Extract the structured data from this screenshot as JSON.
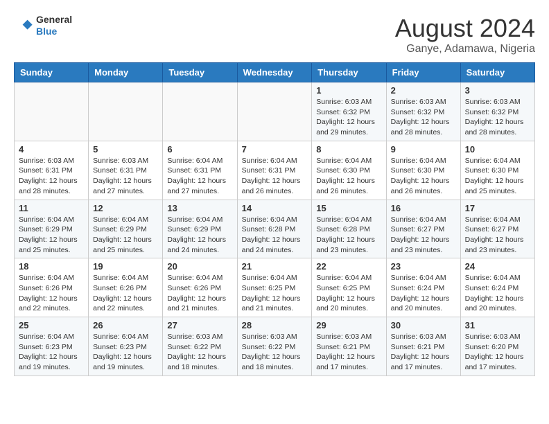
{
  "header": {
    "logo_general": "General",
    "logo_blue": "Blue",
    "month_title": "August 2024",
    "location": "Ganye, Adamawa, Nigeria"
  },
  "days_of_week": [
    "Sunday",
    "Monday",
    "Tuesday",
    "Wednesday",
    "Thursday",
    "Friday",
    "Saturday"
  ],
  "weeks": [
    [
      {
        "day": "",
        "info": ""
      },
      {
        "day": "",
        "info": ""
      },
      {
        "day": "",
        "info": ""
      },
      {
        "day": "",
        "info": ""
      },
      {
        "day": "1",
        "info": "Sunrise: 6:03 AM\nSunset: 6:32 PM\nDaylight: 12 hours\nand 29 minutes."
      },
      {
        "day": "2",
        "info": "Sunrise: 6:03 AM\nSunset: 6:32 PM\nDaylight: 12 hours\nand 28 minutes."
      },
      {
        "day": "3",
        "info": "Sunrise: 6:03 AM\nSunset: 6:32 PM\nDaylight: 12 hours\nand 28 minutes."
      }
    ],
    [
      {
        "day": "4",
        "info": "Sunrise: 6:03 AM\nSunset: 6:31 PM\nDaylight: 12 hours\nand 28 minutes."
      },
      {
        "day": "5",
        "info": "Sunrise: 6:03 AM\nSunset: 6:31 PM\nDaylight: 12 hours\nand 27 minutes."
      },
      {
        "day": "6",
        "info": "Sunrise: 6:04 AM\nSunset: 6:31 PM\nDaylight: 12 hours\nand 27 minutes."
      },
      {
        "day": "7",
        "info": "Sunrise: 6:04 AM\nSunset: 6:31 PM\nDaylight: 12 hours\nand 26 minutes."
      },
      {
        "day": "8",
        "info": "Sunrise: 6:04 AM\nSunset: 6:30 PM\nDaylight: 12 hours\nand 26 minutes."
      },
      {
        "day": "9",
        "info": "Sunrise: 6:04 AM\nSunset: 6:30 PM\nDaylight: 12 hours\nand 26 minutes."
      },
      {
        "day": "10",
        "info": "Sunrise: 6:04 AM\nSunset: 6:30 PM\nDaylight: 12 hours\nand 25 minutes."
      }
    ],
    [
      {
        "day": "11",
        "info": "Sunrise: 6:04 AM\nSunset: 6:29 PM\nDaylight: 12 hours\nand 25 minutes."
      },
      {
        "day": "12",
        "info": "Sunrise: 6:04 AM\nSunset: 6:29 PM\nDaylight: 12 hours\nand 25 minutes."
      },
      {
        "day": "13",
        "info": "Sunrise: 6:04 AM\nSunset: 6:29 PM\nDaylight: 12 hours\nand 24 minutes."
      },
      {
        "day": "14",
        "info": "Sunrise: 6:04 AM\nSunset: 6:28 PM\nDaylight: 12 hours\nand 24 minutes."
      },
      {
        "day": "15",
        "info": "Sunrise: 6:04 AM\nSunset: 6:28 PM\nDaylight: 12 hours\nand 23 minutes."
      },
      {
        "day": "16",
        "info": "Sunrise: 6:04 AM\nSunset: 6:27 PM\nDaylight: 12 hours\nand 23 minutes."
      },
      {
        "day": "17",
        "info": "Sunrise: 6:04 AM\nSunset: 6:27 PM\nDaylight: 12 hours\nand 23 minutes."
      }
    ],
    [
      {
        "day": "18",
        "info": "Sunrise: 6:04 AM\nSunset: 6:26 PM\nDaylight: 12 hours\nand 22 minutes."
      },
      {
        "day": "19",
        "info": "Sunrise: 6:04 AM\nSunset: 6:26 PM\nDaylight: 12 hours\nand 22 minutes."
      },
      {
        "day": "20",
        "info": "Sunrise: 6:04 AM\nSunset: 6:26 PM\nDaylight: 12 hours\nand 21 minutes."
      },
      {
        "day": "21",
        "info": "Sunrise: 6:04 AM\nSunset: 6:25 PM\nDaylight: 12 hours\nand 21 minutes."
      },
      {
        "day": "22",
        "info": "Sunrise: 6:04 AM\nSunset: 6:25 PM\nDaylight: 12 hours\nand 20 minutes."
      },
      {
        "day": "23",
        "info": "Sunrise: 6:04 AM\nSunset: 6:24 PM\nDaylight: 12 hours\nand 20 minutes."
      },
      {
        "day": "24",
        "info": "Sunrise: 6:04 AM\nSunset: 6:24 PM\nDaylight: 12 hours\nand 20 minutes."
      }
    ],
    [
      {
        "day": "25",
        "info": "Sunrise: 6:04 AM\nSunset: 6:23 PM\nDaylight: 12 hours\nand 19 minutes."
      },
      {
        "day": "26",
        "info": "Sunrise: 6:04 AM\nSunset: 6:23 PM\nDaylight: 12 hours\nand 19 minutes."
      },
      {
        "day": "27",
        "info": "Sunrise: 6:03 AM\nSunset: 6:22 PM\nDaylight: 12 hours\nand 18 minutes."
      },
      {
        "day": "28",
        "info": "Sunrise: 6:03 AM\nSunset: 6:22 PM\nDaylight: 12 hours\nand 18 minutes."
      },
      {
        "day": "29",
        "info": "Sunrise: 6:03 AM\nSunset: 6:21 PM\nDaylight: 12 hours\nand 17 minutes."
      },
      {
        "day": "30",
        "info": "Sunrise: 6:03 AM\nSunset: 6:21 PM\nDaylight: 12 hours\nand 17 minutes."
      },
      {
        "day": "31",
        "info": "Sunrise: 6:03 AM\nSunset: 6:20 PM\nDaylight: 12 hours\nand 17 minutes."
      }
    ]
  ]
}
